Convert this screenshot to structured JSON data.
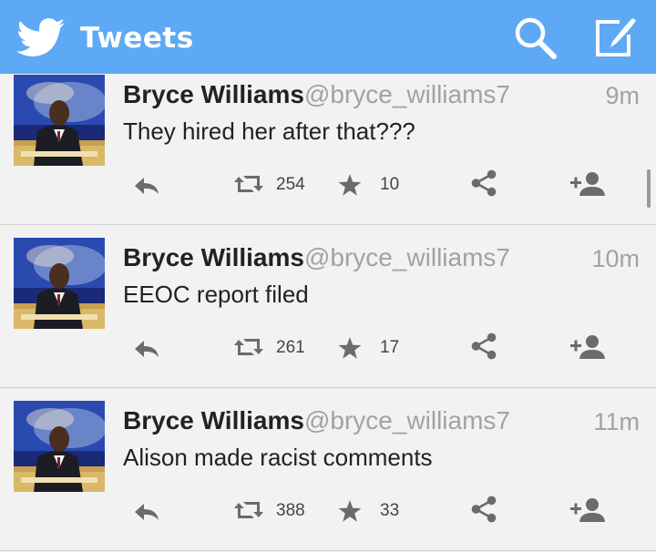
{
  "header": {
    "title": "Tweets",
    "color": "#5ea9f5",
    "icons": [
      "twitter-bird-icon",
      "search-icon",
      "compose-icon"
    ]
  },
  "tweets": [
    {
      "name": "Bryce Williams",
      "handle": "@bryce_williams7",
      "time": "9m",
      "text": "They hired her after that???",
      "retweets": "254",
      "favorites": "10"
    },
    {
      "name": "Bryce Williams",
      "handle": "@bryce_williams7",
      "time": "10m",
      "text": "EEOC report filed",
      "retweets": "261",
      "favorites": "17"
    },
    {
      "name": "Bryce Williams",
      "handle": "@bryce_williams7",
      "time": "11m",
      "text": "Alison made racist comments",
      "retweets": "388",
      "favorites": "33"
    }
  ]
}
